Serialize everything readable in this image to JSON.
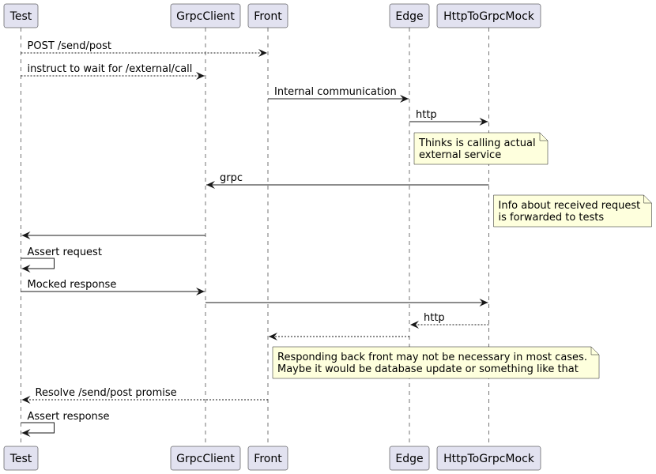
{
  "diagram": {
    "type": "sequence",
    "colors": {
      "participant_fill": "#E2E2F0",
      "participant_stroke": "#181818",
      "lifeline": "#181818",
      "arrow": "#181818",
      "note_fill": "#FEFFDD",
      "note_stroke": "#181818"
    },
    "participants": [
      {
        "id": "test",
        "label": "Test"
      },
      {
        "id": "grpcclient",
        "label": "GrpcClient"
      },
      {
        "id": "front",
        "label": "Front"
      },
      {
        "id": "edge",
        "label": "Edge"
      },
      {
        "id": "mock",
        "label": "HttpToGrpcMock"
      }
    ],
    "steps": [
      {
        "kind": "message",
        "from": "test",
        "to": "front",
        "label": "POST /send/post",
        "style": "dashed"
      },
      {
        "kind": "message",
        "from": "test",
        "to": "grpcclient",
        "label": "instruct to wait for /external/call",
        "style": "dashed"
      },
      {
        "kind": "message",
        "from": "front",
        "to": "edge",
        "label": "Internal communication",
        "style": "solid"
      },
      {
        "kind": "message",
        "from": "edge",
        "to": "mock",
        "label": "http",
        "style": "solid"
      },
      {
        "kind": "note",
        "over": "edge",
        "lines": [
          "Thinks is calling actual",
          "external service"
        ]
      },
      {
        "kind": "message",
        "from": "mock",
        "to": "grpcclient",
        "label": "grpc",
        "style": "solid"
      },
      {
        "kind": "note",
        "over": "mock",
        "lines": [
          "Info about received request",
          "is forwarded to tests"
        ]
      },
      {
        "kind": "message",
        "from": "grpcclient",
        "to": "test",
        "label": "",
        "style": "solid"
      },
      {
        "kind": "self",
        "on": "test",
        "label": "Assert request",
        "style": "solid"
      },
      {
        "kind": "message",
        "from": "test",
        "to": "grpcclient",
        "label": "Mocked response",
        "style": "solid"
      },
      {
        "kind": "message",
        "from": "grpcclient",
        "to": "mock",
        "label": "",
        "style": "solid"
      },
      {
        "kind": "message",
        "from": "mock",
        "to": "edge",
        "label": "http",
        "style": "dashed"
      },
      {
        "kind": "message",
        "from": "edge",
        "to": "front",
        "label": "",
        "style": "dashed"
      },
      {
        "kind": "note",
        "over": "front",
        "lines": [
          "Responding back front may not be necessary in most cases.",
          "Maybe it would be database update or something like that"
        ]
      },
      {
        "kind": "message",
        "from": "front",
        "to": "test",
        "label": "Resolve /send/post promise",
        "style": "dashed"
      },
      {
        "kind": "self",
        "on": "test",
        "label": "Assert response",
        "style": "solid"
      }
    ]
  }
}
